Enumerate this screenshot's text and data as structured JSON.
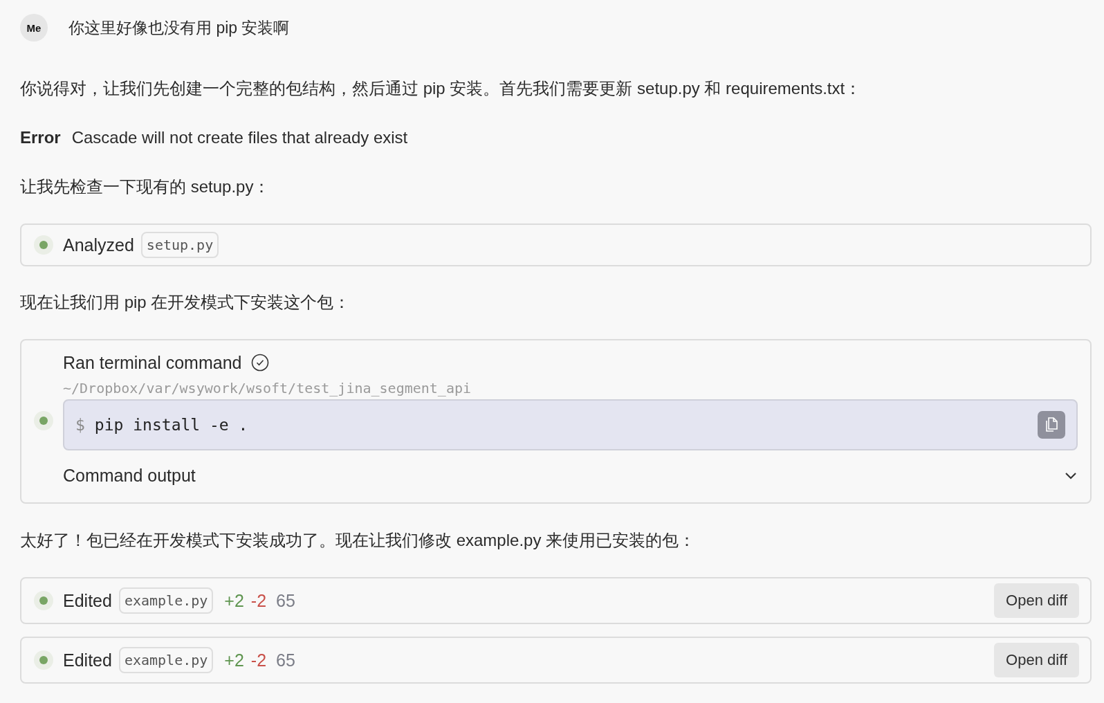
{
  "user_message": {
    "avatar": "Me",
    "text": "你这里好像也没有用 pip 安装啊"
  },
  "blocks": [
    {
      "kind": "text",
      "text": "你说得对，让我们先创建一个完整的包结构，然后通过 pip 安装。首先我们需要更新 setup.py 和 requirements.txt："
    },
    {
      "kind": "error",
      "label": "Error",
      "text": "Cascade will not create files that already exist"
    },
    {
      "kind": "text",
      "text": "让我先检查一下现有的 setup.py："
    },
    {
      "kind": "analyzed",
      "action": "Analyzed",
      "file": "setup.py"
    },
    {
      "kind": "text",
      "text": "现在让我们用 pip 在开发模式下安装这个包："
    },
    {
      "kind": "terminal",
      "title": "Ran terminal command",
      "path": "~/Dropbox/var/wsywork/wsoft/test_jina_segment_api",
      "prompt": "$",
      "command": "pip install -e .",
      "output_label": "Command output",
      "expanded": false
    },
    {
      "kind": "text",
      "text": "太好了！包已经在开发模式下安装成功了。现在让我们修改 example.py 来使用已安装的包："
    },
    {
      "kind": "edited",
      "action": "Edited",
      "file": "example.py",
      "added": "+2",
      "removed": "-2",
      "line": "65",
      "button": "Open diff"
    },
    {
      "kind": "edited",
      "action": "Edited",
      "file": "example.py",
      "added": "+2",
      "removed": "-2",
      "line": "65",
      "button": "Open diff"
    }
  ]
}
